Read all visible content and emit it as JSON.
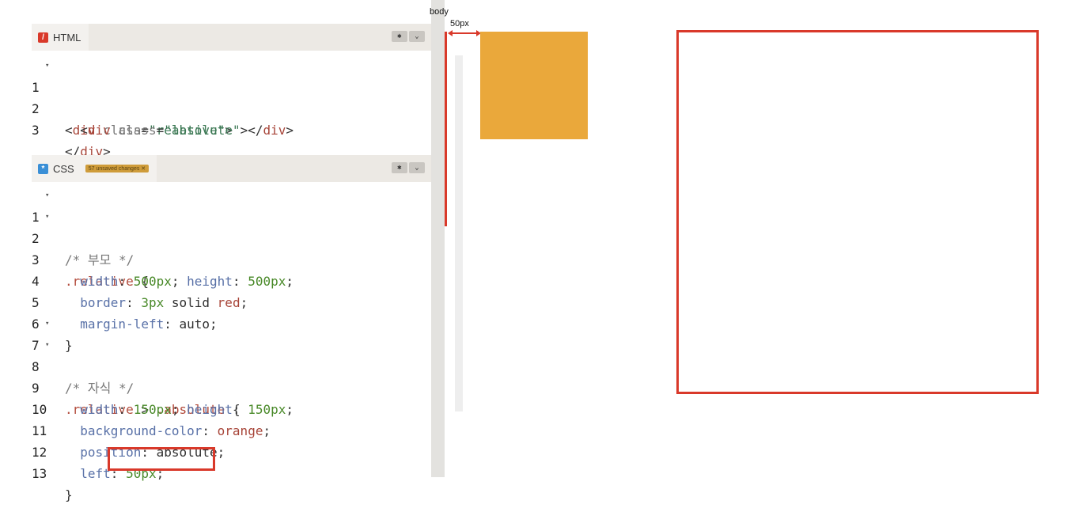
{
  "html_panel": {
    "tab_label": "HTML",
    "icon": "html-icon",
    "lines": [
      {
        "n": "1",
        "fold": true
      },
      {
        "n": "2",
        "fold": false
      },
      {
        "n": "3",
        "fold": false
      }
    ]
  },
  "css_panel": {
    "tab_label": "CSS",
    "icon": "css-icon",
    "badge": "57 unsaved changes ✕",
    "lines": [
      {
        "n": "1"
      },
      {
        "n": "2"
      },
      {
        "n": "3"
      },
      {
        "n": "4"
      },
      {
        "n": "5"
      },
      {
        "n": "6"
      },
      {
        "n": "7"
      },
      {
        "n": "8"
      },
      {
        "n": "9"
      },
      {
        "n": "10"
      },
      {
        "n": "11"
      },
      {
        "n": "12"
      },
      {
        "n": "13"
      }
    ]
  },
  "header_buttons": {
    "settings_icon": "gear-icon",
    "dropdown_icon": "chevron-down-icon"
  },
  "preview": {
    "body_label": "body",
    "offset_label": "50px"
  },
  "code": {
    "h1": [
      "<div class=\"relative\">"
    ],
    "css": {
      "c1": "/* 부모 */",
      "c7": "/* 자식 */"
    }
  },
  "colors": {
    "orange": "#eaa83b",
    "red": "#d9392a"
  }
}
